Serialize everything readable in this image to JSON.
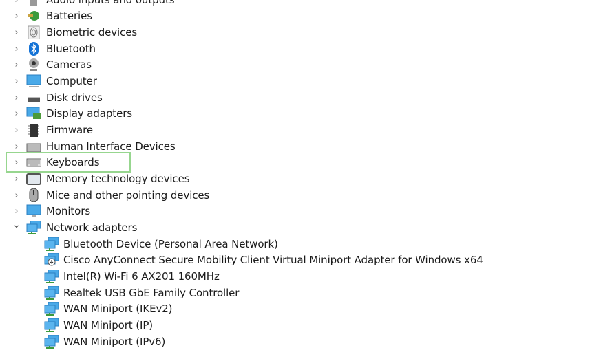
{
  "tree": {
    "categories": [
      {
        "label": "Audio inputs and outputs",
        "icon": "speaker-icon",
        "expanded": false
      },
      {
        "label": "Batteries",
        "icon": "battery-icon",
        "expanded": false
      },
      {
        "label": "Biometric devices",
        "icon": "fingerprint-icon",
        "expanded": false
      },
      {
        "label": "Bluetooth",
        "icon": "bluetooth-icon",
        "expanded": false
      },
      {
        "label": "Cameras",
        "icon": "webcam-icon",
        "expanded": false
      },
      {
        "label": "Computer",
        "icon": "computer-icon",
        "expanded": false
      },
      {
        "label": "Disk drives",
        "icon": "disk-drive-icon",
        "expanded": false
      },
      {
        "label": "Display adapters",
        "icon": "display-adapter-icon",
        "expanded": false
      },
      {
        "label": "Firmware",
        "icon": "firmware-chip-icon",
        "expanded": false
      },
      {
        "label": "Human Interface Devices",
        "icon": "hid-icon",
        "expanded": false
      },
      {
        "label": "Keyboards",
        "icon": "keyboard-icon",
        "expanded": false,
        "highlighted": true
      },
      {
        "label": "Memory technology devices",
        "icon": "memory-card-icon",
        "expanded": false
      },
      {
        "label": "Mice and other pointing devices",
        "icon": "mouse-icon",
        "expanded": false
      },
      {
        "label": "Monitors",
        "icon": "monitor-icon",
        "expanded": false
      },
      {
        "label": "Network adapters",
        "icon": "network-adapter-icon",
        "expanded": true
      }
    ],
    "network_adapters": [
      {
        "label": "Bluetooth Device (Personal Area Network)",
        "icon": "network-adapter-icon"
      },
      {
        "label": "Cisco AnyConnect Secure Mobility Client Virtual Miniport Adapter for Windows x64",
        "icon": "network-adapter-download-icon"
      },
      {
        "label": "Intel(R) Wi-Fi 6 AX201 160MHz",
        "icon": "network-adapter-icon"
      },
      {
        "label": "Realtek USB GbE Family Controller",
        "icon": "network-adapter-icon"
      },
      {
        "label": "WAN Miniport (IKEv2)",
        "icon": "network-adapter-icon"
      },
      {
        "label": "WAN Miniport (IP)",
        "icon": "network-adapter-icon"
      },
      {
        "label": "WAN Miniport (IPv6)",
        "icon": "network-adapter-icon"
      }
    ],
    "highlight_color": "#97d68f"
  }
}
